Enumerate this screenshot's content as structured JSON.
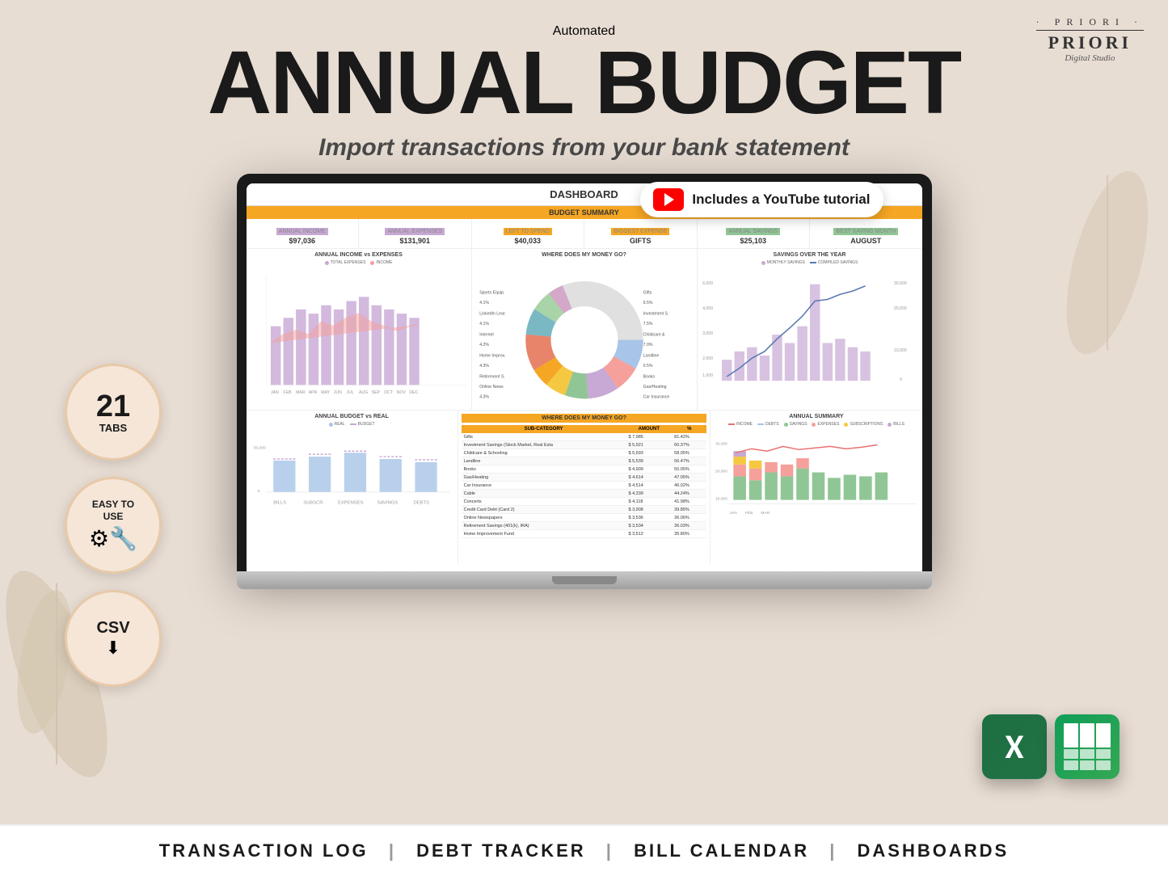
{
  "brand": {
    "dots": "· PRIORI ·",
    "name": "PRIORI",
    "studio": "Digital Studio"
  },
  "header": {
    "title_animated": "Automated",
    "title_main": "ANNUAL BUDGET",
    "title_sub": "Import transactions from your bank statement"
  },
  "youtube_badge": {
    "text": "Includes a YouTube tutorial"
  },
  "dashboard": {
    "title": "DASHBOARD",
    "budget_summary_label": "BUDGET SUMMARY",
    "summary_cells": [
      {
        "label": "ANNUAL INCOME",
        "label_color": "purple",
        "value": "$97,036"
      },
      {
        "label": "ANNUAL EXPENSES",
        "label_color": "purple",
        "value": "$131,901"
      },
      {
        "label": "LEFT TO SPEND",
        "label_color": "orange",
        "value": "$40,033"
      },
      {
        "label": "BIGGEST EXPENSE",
        "label_color": "orange",
        "value": "GIFTS"
      },
      {
        "label": "ANNUAL SAVINGS",
        "label_color": "green",
        "value": "$25,103"
      },
      {
        "label": "BEST SAVING MONTH",
        "label_color": "green",
        "value": "AUGUST"
      }
    ],
    "chart1_title": "ANNUAL INCOME vs EXPENSES",
    "chart1_legend": [
      "TOTAL EXPENSES",
      "INCOME"
    ],
    "chart2_title": "WHERE DOES MY MONEY GO?",
    "chart3_title": "SAVINGS OVER THE YEAR",
    "chart3_legend": [
      "MONTHLY SAVINGS",
      "COMPILED SAVINGS"
    ],
    "chart4_title": "ANNUAL BUDGET vs REAL",
    "chart4_legend": [
      "REAL",
      "BUDGET"
    ],
    "chart5_title": "WHERE DOES MY MONEY GO?",
    "chart5_headers": [
      "SUB-CATEGORY",
      "AMOUNT",
      "%"
    ],
    "chart5_rows": [
      {
        "cat": "Gifts",
        "amount": "7,985",
        "pct": "81.42%"
      },
      {
        "cat": "Investment Savings (Stock Market, Real Esta",
        "amount": "5,921",
        "pct": "60.37%"
      },
      {
        "cat": "Childcare & Schooling",
        "amount": "5,693",
        "pct": "58.05%"
      },
      {
        "cat": "Landline",
        "amount": "5,539",
        "pct": "56.47%"
      },
      {
        "cat": "Books",
        "amount": "4,909",
        "pct": "50.05%"
      },
      {
        "cat": "Gas/Heating",
        "amount": "4,614",
        "pct": "47.05%"
      },
      {
        "cat": "Car Insurance",
        "amount": "4,514",
        "pct": "46.02%"
      },
      {
        "cat": "Cable",
        "amount": "4,339",
        "pct": "44.24%"
      },
      {
        "cat": "Concerts",
        "amount": "4,118",
        "pct": "41.98%"
      },
      {
        "cat": "Credit Card Debt (Card 2)",
        "amount": "3,908",
        "pct": "39.85%"
      },
      {
        "cat": "Online Newspapers",
        "amount": "3,536",
        "pct": "36.06%"
      },
      {
        "cat": "Retirement Savings (401(k), IRA)",
        "amount": "3,534",
        "pct": "36.03%"
      },
      {
        "cat": "Home Improvement Fund",
        "amount": "3,512",
        "pct": "35.80%"
      }
    ],
    "chart6_title": "ANNUAL SUMMARY",
    "chart6_legend": [
      "INCOME",
      "DEBTS",
      "SAVINGS",
      "EXPENSES",
      "SUBSCRIPTIONS",
      "BILLS"
    ]
  },
  "badges": [
    {
      "type": "21tabs",
      "number": "21",
      "label": "TABS"
    },
    {
      "type": "easy",
      "label": "EASY TO\nUSE"
    },
    {
      "type": "csv",
      "label": "CSV"
    }
  ],
  "footer": {
    "items": [
      "TRANSACTION LOG",
      "DEBT TRACKER",
      "BILL CALENDAR",
      "DASHBOARDS"
    ]
  }
}
